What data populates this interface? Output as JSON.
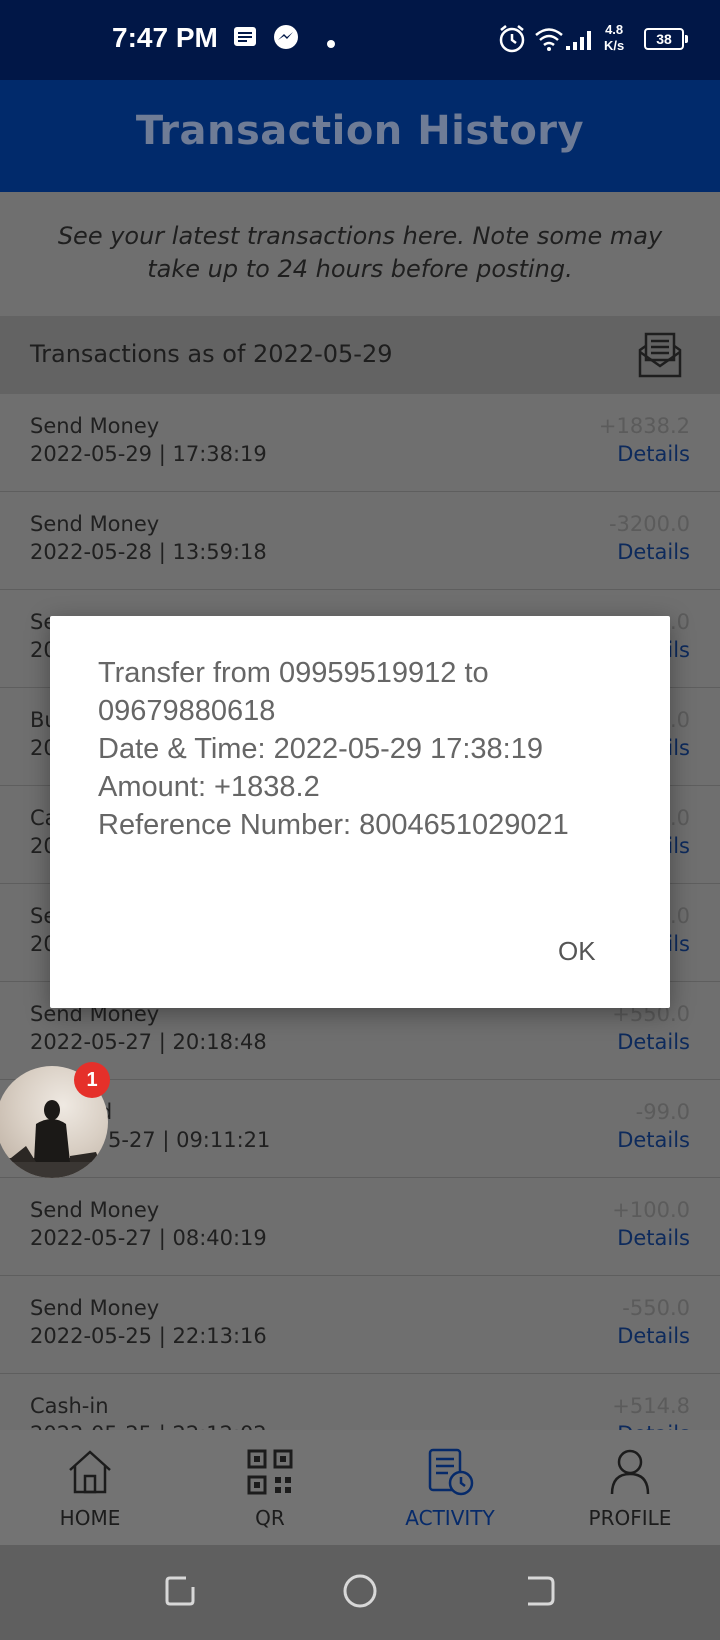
{
  "status_bar": {
    "time": "7:47 PM",
    "net_speed_value": "4.8",
    "net_speed_unit": "K/s",
    "battery": "38",
    "icons": [
      "message-icon",
      "messenger-icon",
      "dot-icon",
      "alarm-icon",
      "wifi-icon",
      "signal-icon",
      "battery-icon"
    ]
  },
  "header": {
    "title": "Transaction History"
  },
  "intro": {
    "text": "See your latest transactions here. Note some may take up to 24 hours before posting."
  },
  "list_header": {
    "label": "Transactions as of 2022-05-29",
    "icon": "statement-icon"
  },
  "transactions": [
    {
      "title": "Send Money",
      "datetime": "2022-05-29 | 17:38:19",
      "amount": "+1838.2",
      "link": "Details"
    },
    {
      "title": "Send Money",
      "datetime": "2022-05-28 | 13:59:18",
      "amount": "-3200.0",
      "link": "Details"
    },
    {
      "title": "Se",
      "datetime": "20",
      "amount": ".0",
      "link": "tails"
    },
    {
      "title": "Bu",
      "datetime": "20",
      "amount": ".0",
      "link": "tails"
    },
    {
      "title": "Ca",
      "datetime": "20",
      "amount": ".0",
      "link": "tails"
    },
    {
      "title": "Se",
      "datetime": "20",
      "amount": ".0",
      "link": "tails"
    },
    {
      "title": "Send Money",
      "datetime": "2022-05-27 | 20:18:48",
      "amount": "+550.0",
      "link": "Details"
    },
    {
      "title": "ad",
      "datetime": "5-27 | 09:11:21",
      "amount": "-99.0",
      "link": "Details"
    },
    {
      "title": "Send Money",
      "datetime": "2022-05-27 | 08:40:19",
      "amount": "+100.0",
      "link": "Details"
    },
    {
      "title": "Send Money",
      "datetime": "2022-05-25 | 22:13:16",
      "amount": "-550.0",
      "link": "Details"
    },
    {
      "title": "Cash-in",
      "datetime": "2022-05-25 | 22:12:02",
      "amount": "+514.8",
      "link": "Details"
    }
  ],
  "bottom_nav": [
    {
      "label": "HOME",
      "icon": "home-icon",
      "active": false
    },
    {
      "label": "QR",
      "icon": "qr-icon",
      "active": false
    },
    {
      "label": "ACTIVITY",
      "icon": "activity-icon",
      "active": true
    },
    {
      "label": "PROFILE",
      "icon": "profile-icon",
      "active": false
    }
  ],
  "dialog": {
    "line1": "Transfer from 09959519912 to",
    "line2": "09679880618",
    "line3": "Date & Time: 2022-05-29 17:38:19",
    "line4": "Amount: +1838.2",
    "line5": "Reference Number: 8004651029021",
    "ok_label": "OK"
  },
  "chat_head": {
    "badge": "1"
  },
  "colors": {
    "status_bar": "#011747",
    "app_bar": "#012a6b",
    "accent": "#1b4f9c",
    "badge": "#e5302a"
  }
}
